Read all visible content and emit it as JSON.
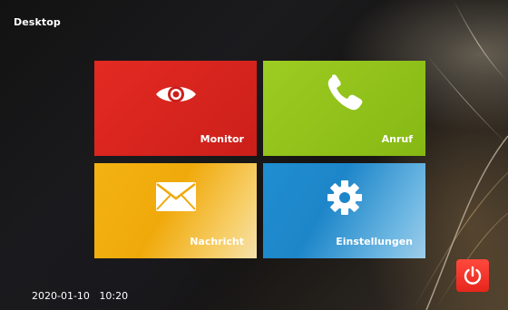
{
  "window": {
    "title": "Desktop"
  },
  "tiles": [
    {
      "label": "Monitor",
      "icon": "eye-icon",
      "color": "#e32a22"
    },
    {
      "label": "Anruf",
      "icon": "phone-icon",
      "color": "#9dcc22"
    },
    {
      "label": "Nachricht",
      "icon": "envelope-icon",
      "color": "#f3b313"
    },
    {
      "label": "Einstellungen",
      "icon": "gear-icon",
      "color": "#1f8ed0"
    }
  ],
  "status": {
    "date": "2020-01-10",
    "time": "10:20"
  },
  "power_button": {
    "icon": "power-icon",
    "color": "#e7261c"
  }
}
